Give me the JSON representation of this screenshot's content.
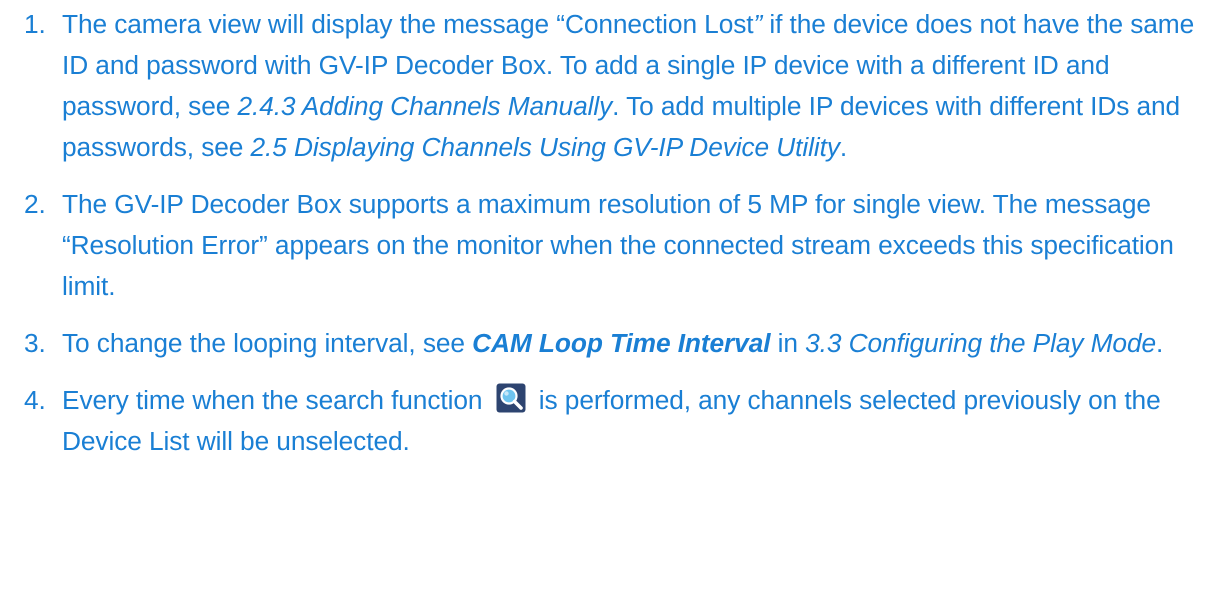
{
  "notes": [
    {
      "number": "1.",
      "t1": "The camera view will display the message “Connection Lost",
      "t2": "”",
      "t3": " if the device does not have the same ID and password with GV-IP Decoder Box. To add a single IP device with a different ID and password, see ",
      "ref1": "2.4.3 Adding Channels Manually",
      "t4": ". To add multiple IP devices with different IDs and passwords, see ",
      "ref2": "2.5 Displaying Channels Using GV-IP Device Utility",
      "t5": "."
    },
    {
      "number": "2.",
      "t1": "The GV-IP Decoder Box supports a maximum resolution of 5 MP for single view. The message “Resolution Error” appears on the monitor when the connected stream exceeds this specification limit."
    },
    {
      "number": "3.",
      "t1": "To change the looping interval, see ",
      "setting": "CAM Loop Time Interval",
      "t2": " in ",
      "ref": "3.3 Configuring the Play Mode",
      "t3": "."
    },
    {
      "number": "4.",
      "t1": "Every time when the search function ",
      "icon": "magnifier-search-icon",
      "t2": " is performed, any channels selected previously on the Device List will be unselected."
    }
  ],
  "colors": {
    "text": "#1a7fd4",
    "icon_background": "#2d4470",
    "icon_lens": "#6ec4ef"
  }
}
